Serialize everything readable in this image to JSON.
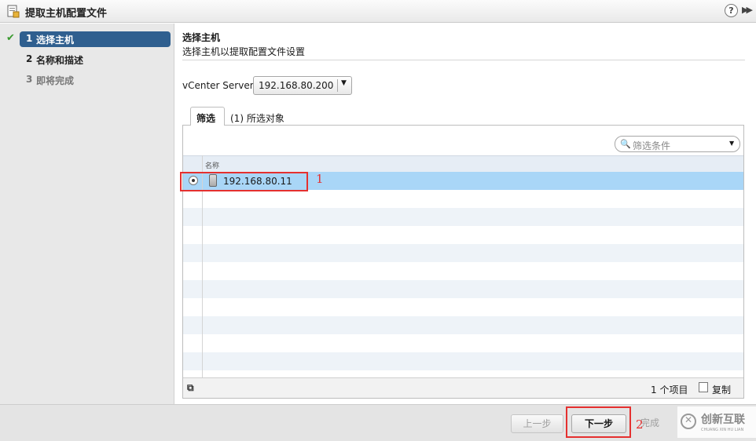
{
  "window": {
    "title": "提取主机配置文件",
    "help": "?",
    "expand": "▶▶"
  },
  "steps": [
    {
      "num": "1",
      "label": "选择主机",
      "state": "active",
      "done_mark": "✔"
    },
    {
      "num": "2",
      "label": "名称和描述",
      "state": "done"
    },
    {
      "num": "3",
      "label": "即将完成",
      "state": "pending"
    }
  ],
  "page": {
    "title": "选择主机",
    "subtitle": "选择主机以提取配置文件设置"
  },
  "vcenter": {
    "label": "vCenter Server:",
    "value": "192.168.80.200"
  },
  "tabs": [
    {
      "label": "筛选",
      "active": true
    },
    {
      "label": "(1) 所选对象",
      "active": false
    }
  ],
  "filter": {
    "placeholder": "筛选条件"
  },
  "grid": {
    "column": "名称",
    "rows": [
      {
        "name": "192.168.80.11",
        "selected": true
      }
    ]
  },
  "grid_footer": {
    "count": "1 个项目",
    "copy": "复制"
  },
  "buttons": {
    "prev": "上一步",
    "next": "下一步",
    "finish": "完成"
  },
  "annotations": {
    "one": "1",
    "two": "2"
  },
  "watermark": {
    "brand": "创新互联",
    "tagline": "CHUANG XIN HU LIAN"
  },
  "colors": {
    "selection": "#a9d6f7",
    "active_step": "#2f5f8f",
    "annotation": "#e5302f"
  }
}
